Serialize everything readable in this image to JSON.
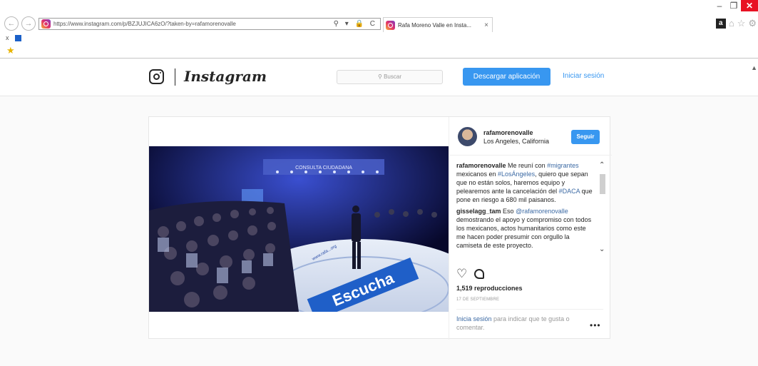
{
  "browser": {
    "url": "https://www.instagram.com/p/BZJUJICA6zO/?taken-by=rafamorenovalle",
    "tab_title": "Rafa Moreno Valle en Insta...",
    "tab_close": "×",
    "addr_tools": "⚲ ▾ 🔒 C",
    "row2_x": "x",
    "window": {
      "minimize": "–",
      "restore": "❐",
      "close": "✕"
    },
    "nav": {
      "back": "←",
      "forward": "→"
    },
    "toolbar_icons": [
      "amazon-icon",
      "home-icon",
      "star-icon",
      "gear-icon"
    ]
  },
  "header": {
    "brand": "Instagram",
    "search_placeholder": "⚲ Buscar",
    "download_label": "Descargar aplicación",
    "login_label": "Iniciar sesión"
  },
  "post": {
    "username": "rafamorenovalle",
    "location": "Los Angeles, California",
    "follow_label": "Seguir",
    "caption": {
      "user": "rafamorenovalle",
      "parts": [
        "Me reuní con ",
        "#migrantes",
        " mexicanos en ",
        "#LosÁngeles",
        ", quiero que sepan que no están solos, haremos equipo y pelearemos ante la cancelación del ",
        "#DACA",
        " que pone en riesgo a 680 mil paisanos."
      ]
    },
    "comment": {
      "user": "gisselagg_tam",
      "parts": [
        "Eso ",
        "@rafamorenovalle",
        " demostrando el apoyo y compromiso con todos los mexicanos, actos humanitarios como este me hacen poder presumir con orgullo la camiseta de este proyecto."
      ]
    },
    "views": "1,519 reproducciones",
    "date": "17 DE SEPTIEMBRE",
    "login_prompt_link": "Inicia sesión",
    "login_prompt_rest": " para indicar que te gusta o comentar.",
    "more": "•••",
    "scene": {
      "banner": "CONSULTA CIUDADANA",
      "floor": "Escucha",
      "floor_small": "www.rafa...org"
    }
  },
  "colors": {
    "accent": "#3897f0",
    "link": "#3c6aa4",
    "stage": "#0a0b3a"
  }
}
